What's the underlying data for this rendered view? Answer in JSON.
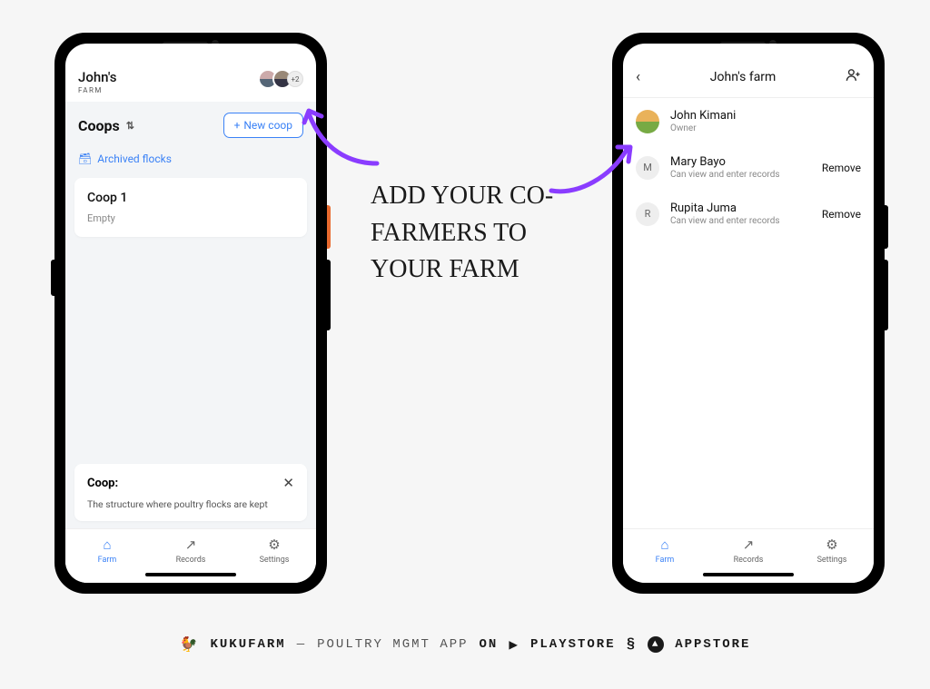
{
  "annotation": "Add your co-farmers to your farm",
  "left": {
    "header": {
      "title": "John's",
      "subtitle": "FARM",
      "extraCount": "+2"
    },
    "coops": {
      "label": "Coops",
      "newButton": "New coop",
      "archivedLink": "Archived flocks",
      "items": [
        {
          "name": "Coop 1",
          "status": "Empty"
        }
      ]
    },
    "tip": {
      "heading": "Coop:",
      "body": "The structure where poultry flocks are kept"
    }
  },
  "right": {
    "appbar": {
      "title": "John's farm"
    },
    "members": [
      {
        "name": "John Kimani",
        "role": "Owner",
        "removable": false,
        "avatarType": "photo",
        "initial": ""
      },
      {
        "name": "Mary Bayo",
        "role": "Can view and enter records",
        "removable": true,
        "avatarType": "m",
        "initial": "M"
      },
      {
        "name": "Rupita Juma",
        "role": "Can view and enter records",
        "removable": true,
        "avatarType": "r",
        "initial": "R"
      }
    ],
    "removeLabel": "Remove"
  },
  "nav": {
    "tabs": [
      {
        "label": "Farm",
        "icon": "⌂"
      },
      {
        "label": "Records",
        "icon": "↗"
      },
      {
        "label": "Settings",
        "icon": "⚙"
      }
    ]
  },
  "footer": {
    "brand": "KUKUFARM",
    "separator": "—",
    "tagline": "POULTRY MGMT APP",
    "on": "ON",
    "playstore": "PLAYSTORE",
    "appstore": "APPSTORE"
  }
}
